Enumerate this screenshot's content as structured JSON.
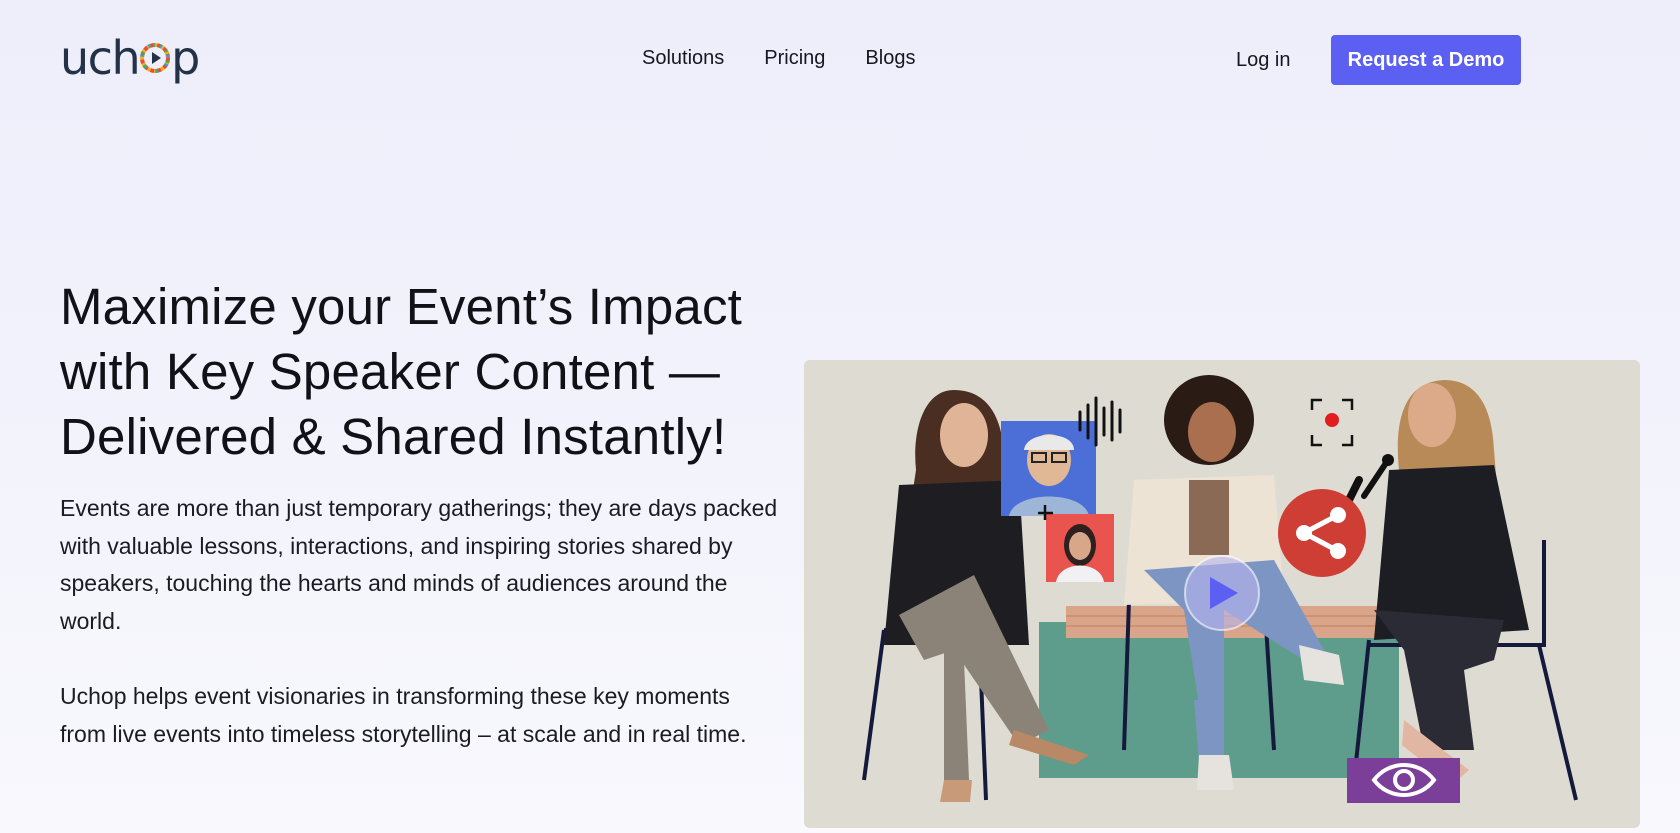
{
  "brand": {
    "logo_text_left": "uch",
    "logo_text_right": "p"
  },
  "nav": {
    "links": [
      "Solutions",
      "Pricing",
      "Blogs"
    ],
    "login": "Log in",
    "cta": "Request a Demo"
  },
  "hero": {
    "title_line1": "Maximize your Event’s Impact",
    "title_line2": "with Key Speaker Content —",
    "title_line3": "Delivered & Shared Instantly!",
    "paragraph1": "Events are more than just temporary gatherings; they are days packed with valuable lessons, interactions, and inspiring stories shared by speakers, touching the hearts and minds of audiences around the world.",
    "paragraph2": "Uchop helps event visionaries in transforming these key moments from live events into timeless storytelling – at scale and in real time."
  },
  "media": {
    "icons": [
      "play-icon",
      "share-icon",
      "eye-icon",
      "record-icon",
      "audio-waveform-icon"
    ]
  },
  "colors": {
    "accent": "#5b5ff2",
    "logo": "#233246",
    "share_red": "#cf3e35",
    "eye_purple": "#7b3f99",
    "carpet_green": "#5d9b8a"
  }
}
